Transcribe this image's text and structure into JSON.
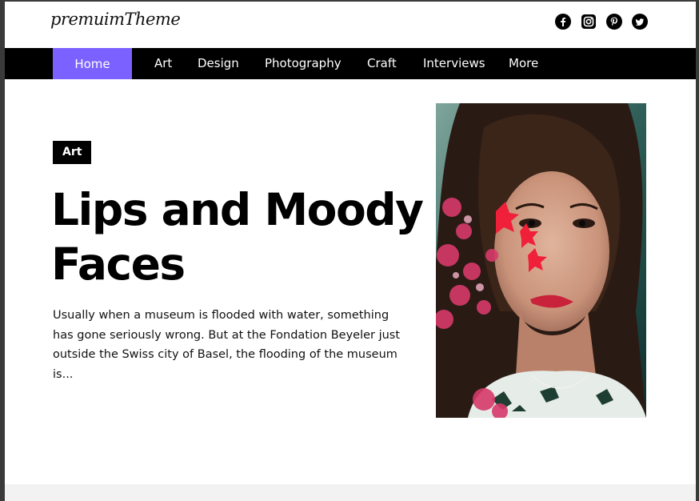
{
  "site": {
    "logo": "premuimTheme"
  },
  "socials": [
    {
      "icon": "facebook-icon"
    },
    {
      "icon": "instagram-icon"
    },
    {
      "icon": "pinterest-icon"
    },
    {
      "icon": "twitter-icon"
    }
  ],
  "nav": {
    "items": [
      {
        "label": "Home",
        "active": true
      },
      {
        "label": "Art"
      },
      {
        "label": "Design"
      },
      {
        "label": "Photography"
      },
      {
        "label": "Craft"
      },
      {
        "label": "Interviews"
      },
      {
        "label": "More"
      }
    ],
    "active_color": "#7b61ff"
  },
  "hero": {
    "category": "Art",
    "title": "Lips and Moody Faces",
    "excerpt": "Usually when a museum is flooded with water, something has gone seriously wrong. But at the Fondation Beyeler just outside the Swiss city of Basel, the flooding of the museum is..."
  }
}
